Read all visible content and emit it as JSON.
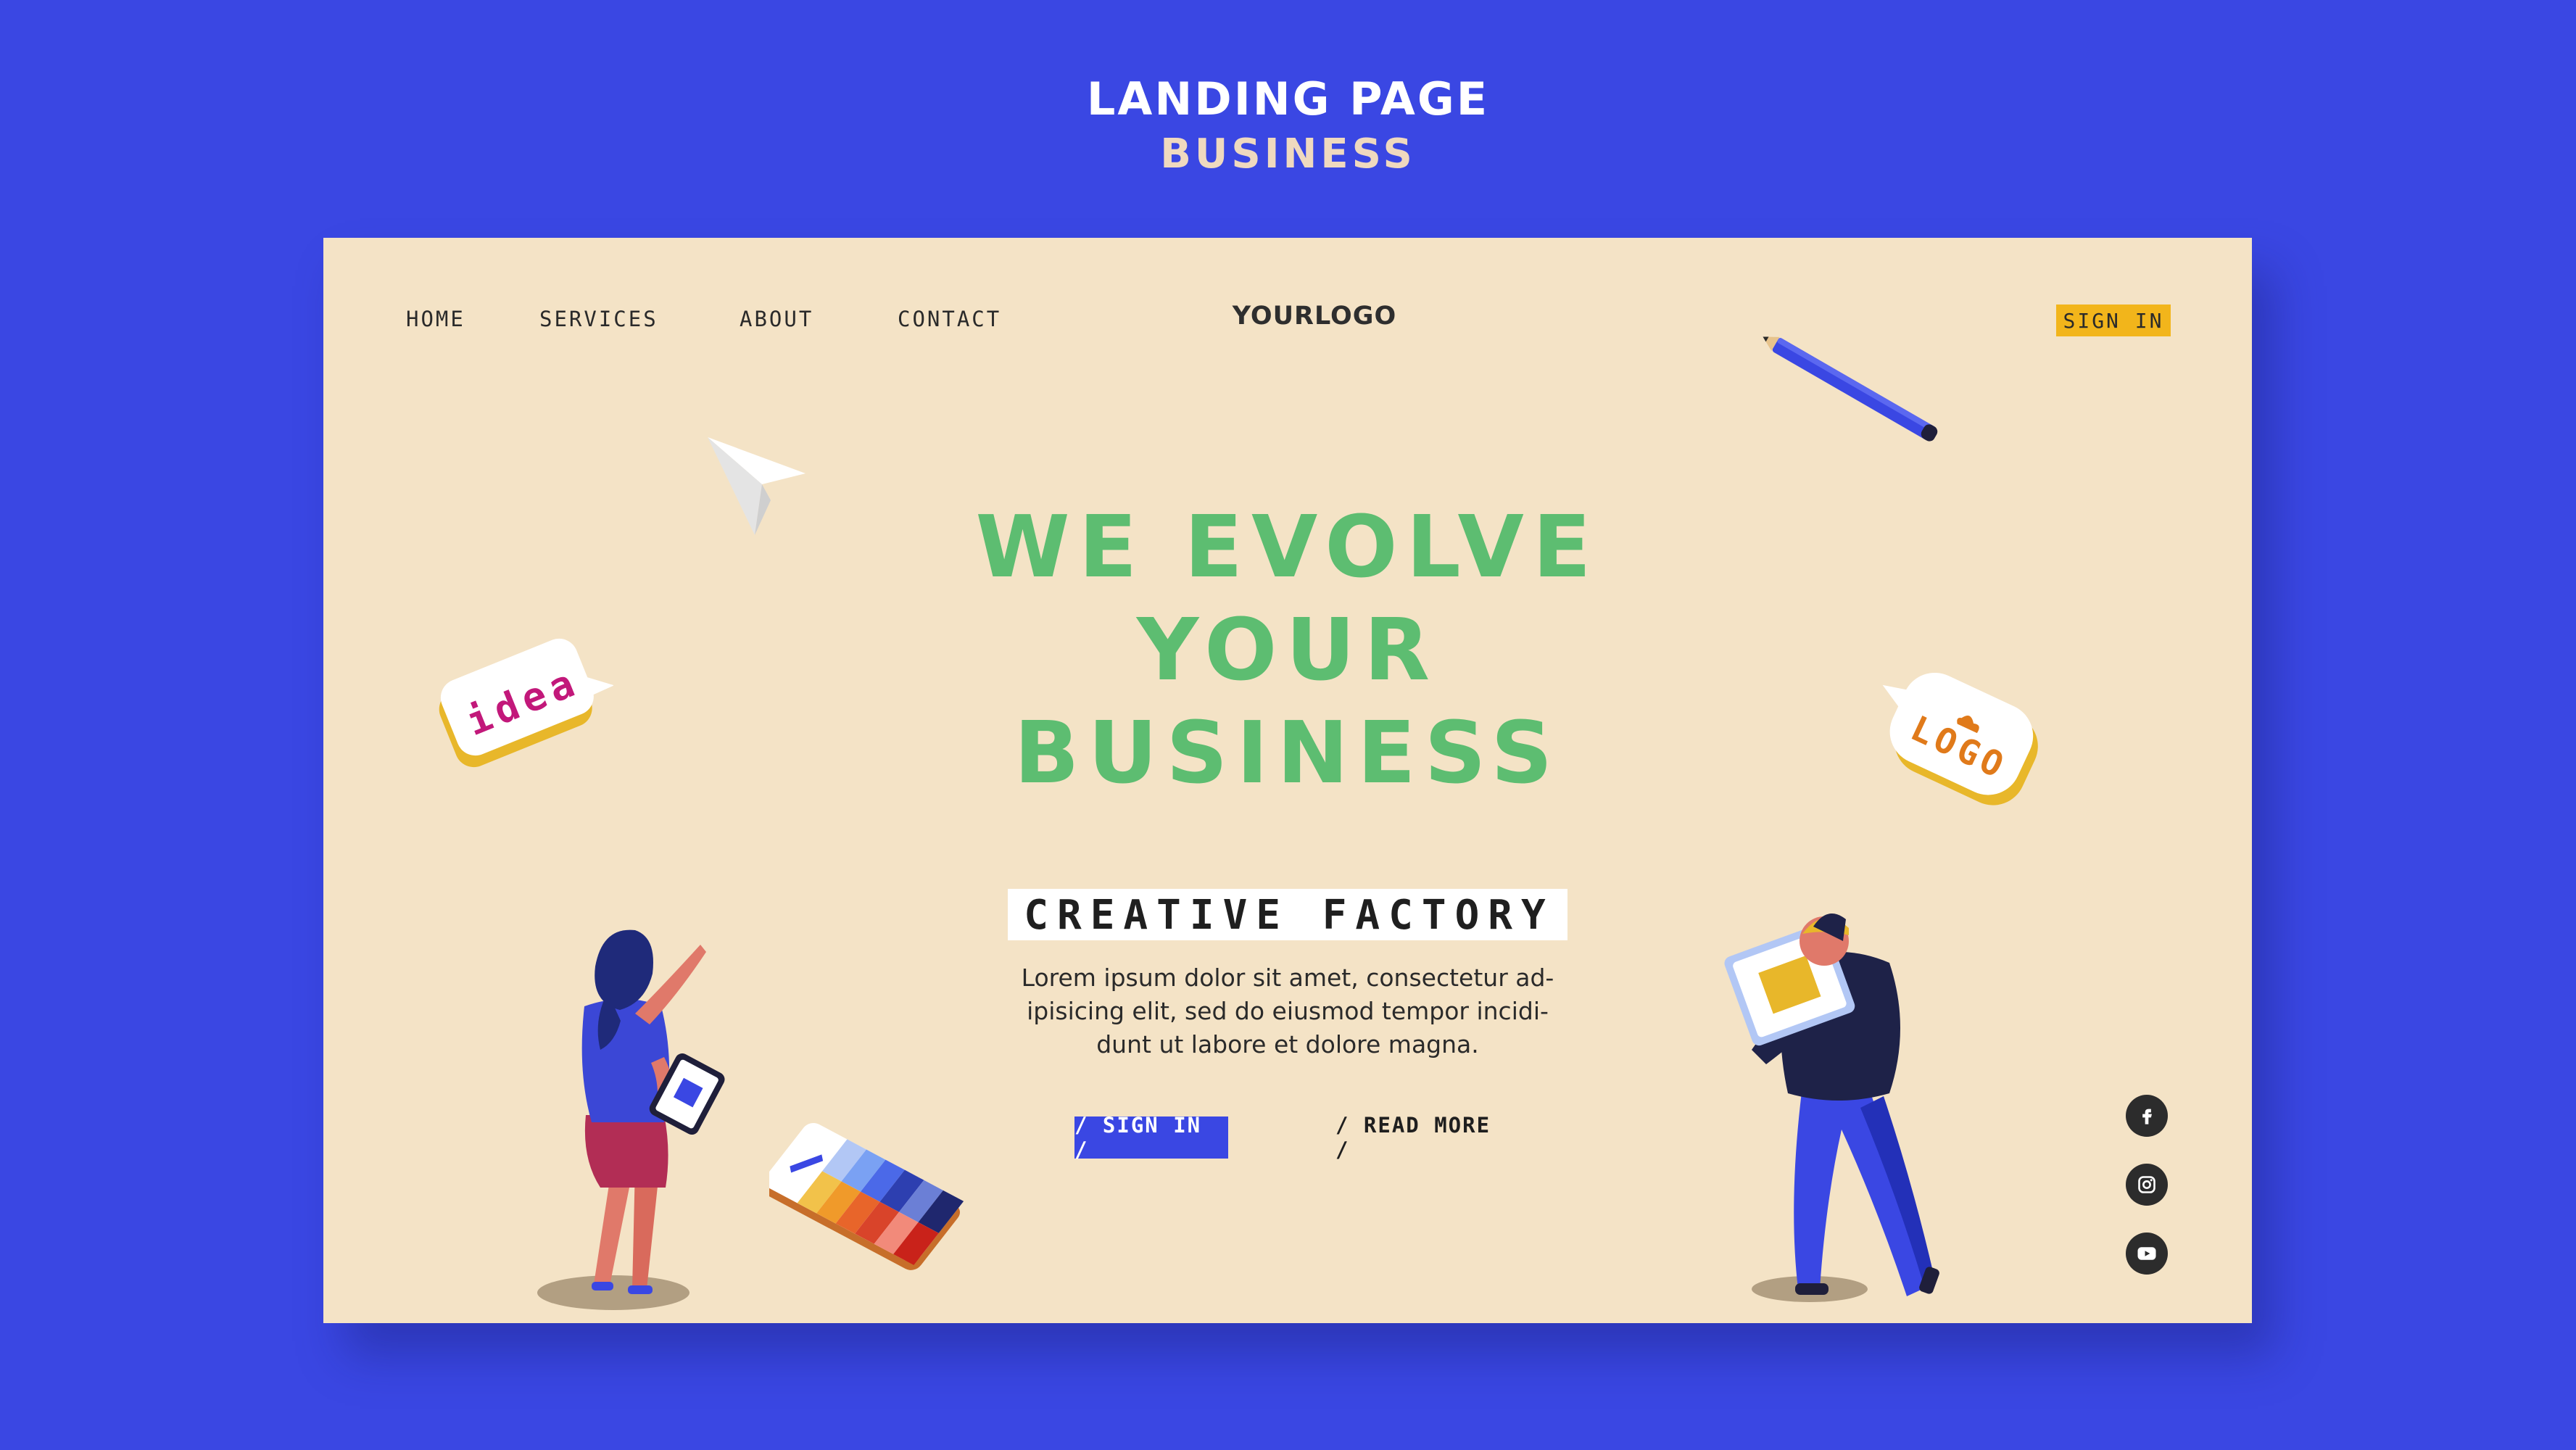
{
  "presentation": {
    "title": "LANDING PAGE",
    "subtitle": "BUSINESS"
  },
  "nav": {
    "items": [
      {
        "label": "HOME"
      },
      {
        "label": "SERVICES"
      },
      {
        "label": "ABOUT"
      },
      {
        "label": "CONTACT"
      }
    ],
    "logo": "YOURLOGO",
    "sign_in": "SIGN IN"
  },
  "hero": {
    "title_lines": [
      "WE EVOLVE",
      "YOUR",
      "BUSINESS"
    ],
    "tagline": "CREATIVE FACTORY",
    "body": "Lorem ipsum dolor sit amet, consectetur ad-\nipisicing elit, sed do eiusmod tempor incidi-\ndunt ut labore et dolore magna.",
    "cta_primary": "/ SIGN IN /",
    "cta_secondary": "/ READ MORE /"
  },
  "illustrations": {
    "idea_bubble_text": "idea",
    "logo_bubble_text": "LOGO"
  },
  "social": [
    {
      "icon": "facebook-icon"
    },
    {
      "icon": "instagram-icon"
    },
    {
      "icon": "youtube-icon"
    }
  ],
  "colors": {
    "background": "#3a47e3",
    "card": "#f4e3c6",
    "headline": "#5dbd71",
    "accent_yellow": "#f2b51b",
    "button_blue": "#3a47e3",
    "social_icon_bg": "#2c2c2c"
  }
}
